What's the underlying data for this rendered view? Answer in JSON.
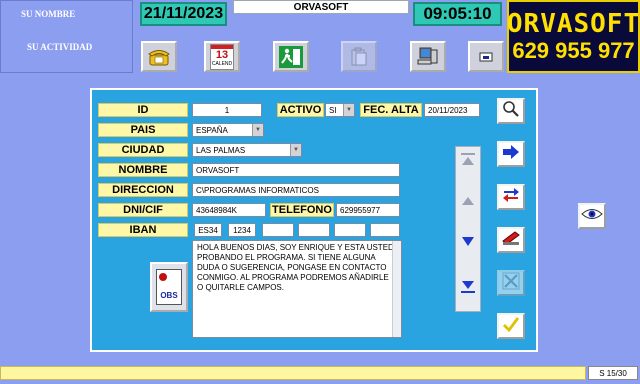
{
  "user": {
    "name": "SU NOMBRE",
    "activity": "SU ACTIVIDAD"
  },
  "header": {
    "date": "21/11/2023",
    "title": "ORVASOFT",
    "time": "09:05:10"
  },
  "logo": {
    "name": "ORVASOFT",
    "phone": "629 955 977"
  },
  "toolbar": {
    "calendar_day": "13",
    "calendar_label": "CALEND"
  },
  "form": {
    "id_label": "ID",
    "id_value": "1",
    "activo_label": "ACTIVO",
    "activo_value": "SI",
    "fec_alta_label": "FEC. ALTA",
    "fec_alta_value": "20/11/2023",
    "pais_label": "PAIS",
    "pais_value": "ESPAÑA",
    "ciudad_label": "CIUDAD",
    "ciudad_value": "LAS PALMAS",
    "nombre_label": "NOMBRE",
    "nombre_value": "ORVASOFT",
    "direccion_label": "DIRECCION",
    "direccion_value": "C\\PROGRAMAS INFORMATICOS",
    "dni_label": "DNI/CIF",
    "dni_value": "43648984K",
    "telefono_label": "TELEFONO",
    "telefono_value": "629955977",
    "iban_label": "IBAN",
    "iban_values": [
      "ES34",
      "1234",
      "",
      "",
      "",
      ""
    ],
    "notes": "HOLA BUENOS DIAS, SOY ENRIQUE Y ESTA USTED PROBANDO EL PROGRAMA. SI TIENE ALGUNA DUDA O SUGERENCIA, PONGASE EN CONTACTO CONMIGO. AL PROGRAMA PODREMOS AÑADIRLE O QUITARLE CAMPOS.",
    "obs_label": "OBS"
  },
  "status": {
    "record": "S 15/30"
  },
  "colors": {
    "background": "#8c9ef0",
    "panel": "#2aa4e0",
    "label_bg": "#fff7a8",
    "accent_teal": "#2ec8b4",
    "logo_yellow": "#ffe000"
  }
}
